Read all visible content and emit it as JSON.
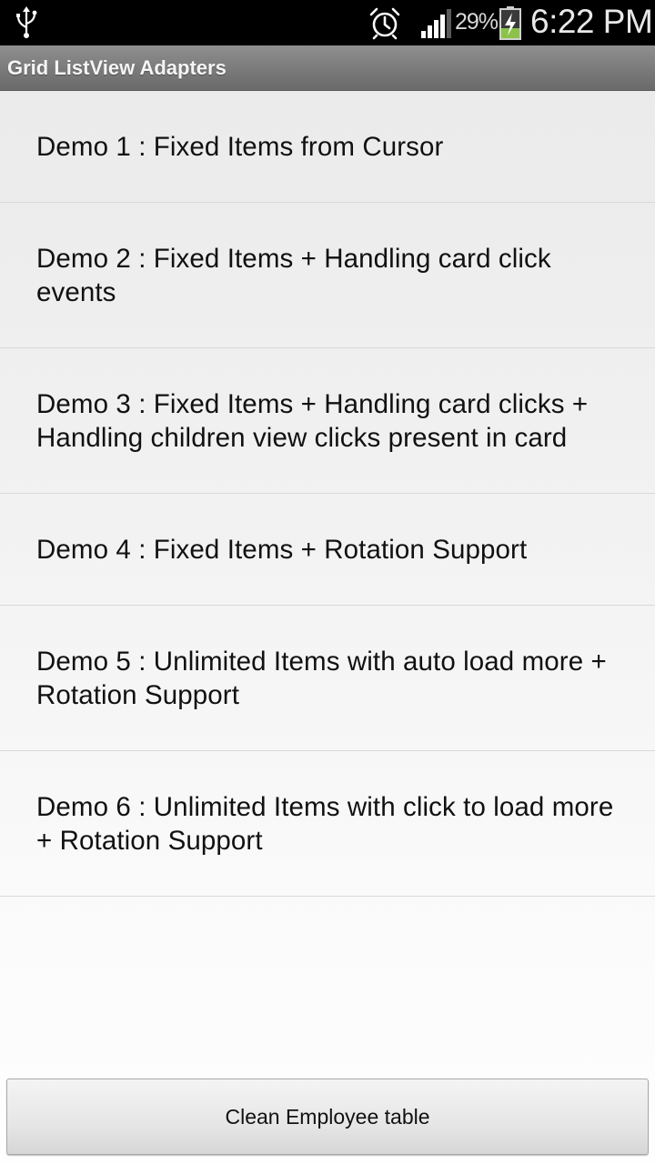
{
  "status_bar": {
    "battery_percent": "29%",
    "time": "6:22 PM",
    "icons": [
      "usb-icon",
      "alarm-clock-icon",
      "signal-strength-icon",
      "battery-charging-icon"
    ]
  },
  "app_bar": {
    "title": "Grid ListView Adapters"
  },
  "demo_list": {
    "items": [
      {
        "label": "Demo 1 : Fixed Items from Cursor"
      },
      {
        "label": "Demo 2 : Fixed Items + Handling card click events"
      },
      {
        "label": "Demo 3 : Fixed Items + Handling card clicks + Handling children view clicks present in card"
      },
      {
        "label": "Demo 4 : Fixed Items + Rotation Support"
      },
      {
        "label": "Demo 5 : Unlimited Items with auto load more + Rotation Support"
      },
      {
        "label": "Demo 6 : Unlimited Items with click to load more + Rotation Support"
      }
    ]
  },
  "footer": {
    "clean_button_label": "Clean Employee table"
  },
  "colors": {
    "status_bar_bg": "#000000",
    "title_bar_bg": "#7a7a7a",
    "list_bg_top": "#e9e9e9",
    "list_bg_bottom": "#fefefe",
    "divider": "#d9d9d9",
    "battery_charge": "#8bc34a"
  }
}
